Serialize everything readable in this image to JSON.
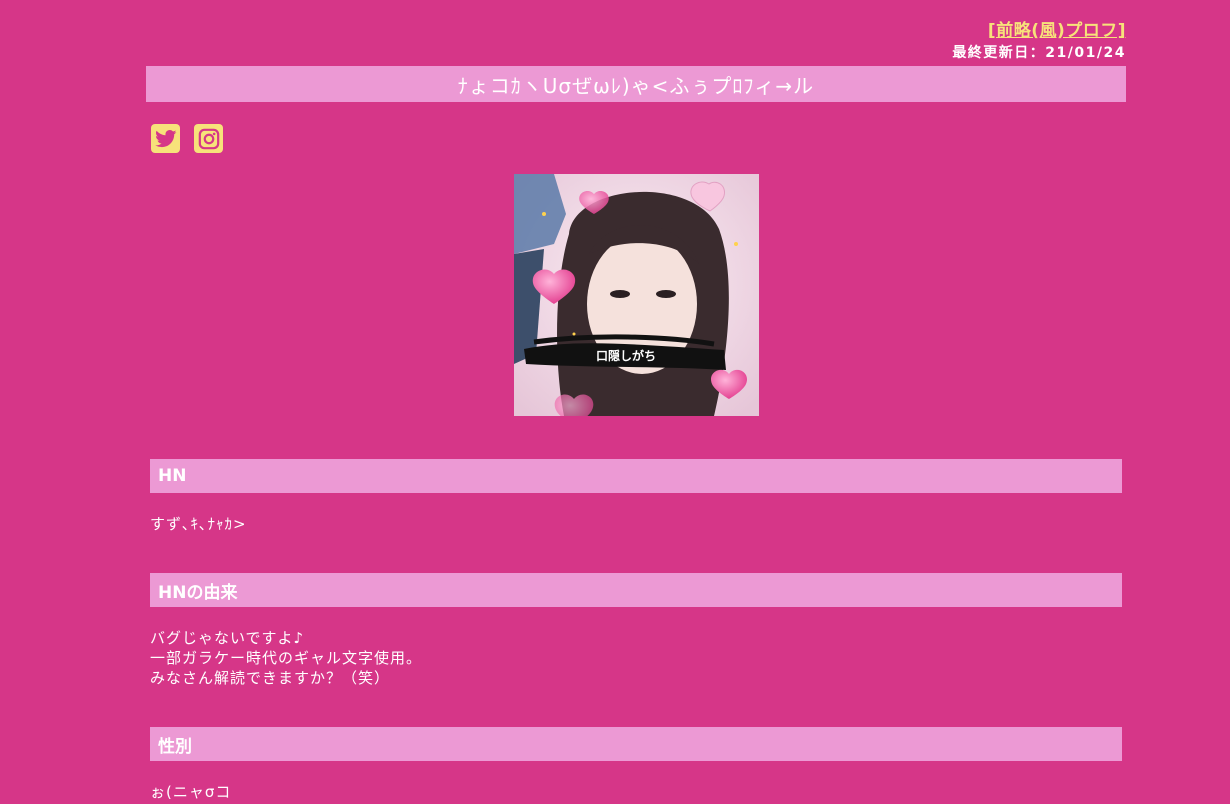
{
  "header": {
    "top_link": "[前略(風)プロフ]",
    "updated": "最終更新日：21/01/24"
  },
  "title": "ﾅょコｶヽUσぜωﾚ)ゃ<ふぅプﾛﾌィ→ル",
  "social": {
    "icons": [
      "twitter-icon",
      "instagram-icon"
    ]
  },
  "photo": {
    "caption": "口隠しがち"
  },
  "sections": [
    {
      "heading": "HN",
      "lines": [
        "すず､ｷ､ﾅｬｶ>"
      ]
    },
    {
      "heading": "HNの由来",
      "lines": [
        "バグじゃないですよ♪",
        "一部ガラケー時代のギャル文字使用。",
        "みなさん解読できますか？（笑）"
      ]
    },
    {
      "heading": "性別",
      "lines": [
        "ぉ(ニャσコ"
      ]
    }
  ],
  "colors": {
    "background": "#d63688",
    "bar": "#ec99d4",
    "accent": "#f7e27a",
    "text": "#ffffff"
  }
}
